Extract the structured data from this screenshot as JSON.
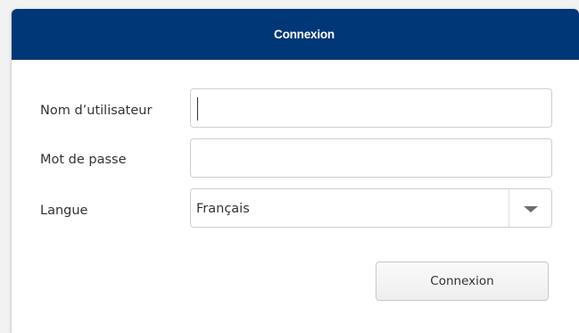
{
  "dialog": {
    "title": "Connexion",
    "header_color": "#003777"
  },
  "form": {
    "username": {
      "label": "Nom d’utilisateur",
      "value": ""
    },
    "password": {
      "label": "Mot de passe",
      "value": ""
    },
    "language": {
      "label": "Langue",
      "selected": "Français"
    },
    "submit_label": "Connexion"
  },
  "icons": {
    "dropdown": "chevron-down-icon"
  }
}
